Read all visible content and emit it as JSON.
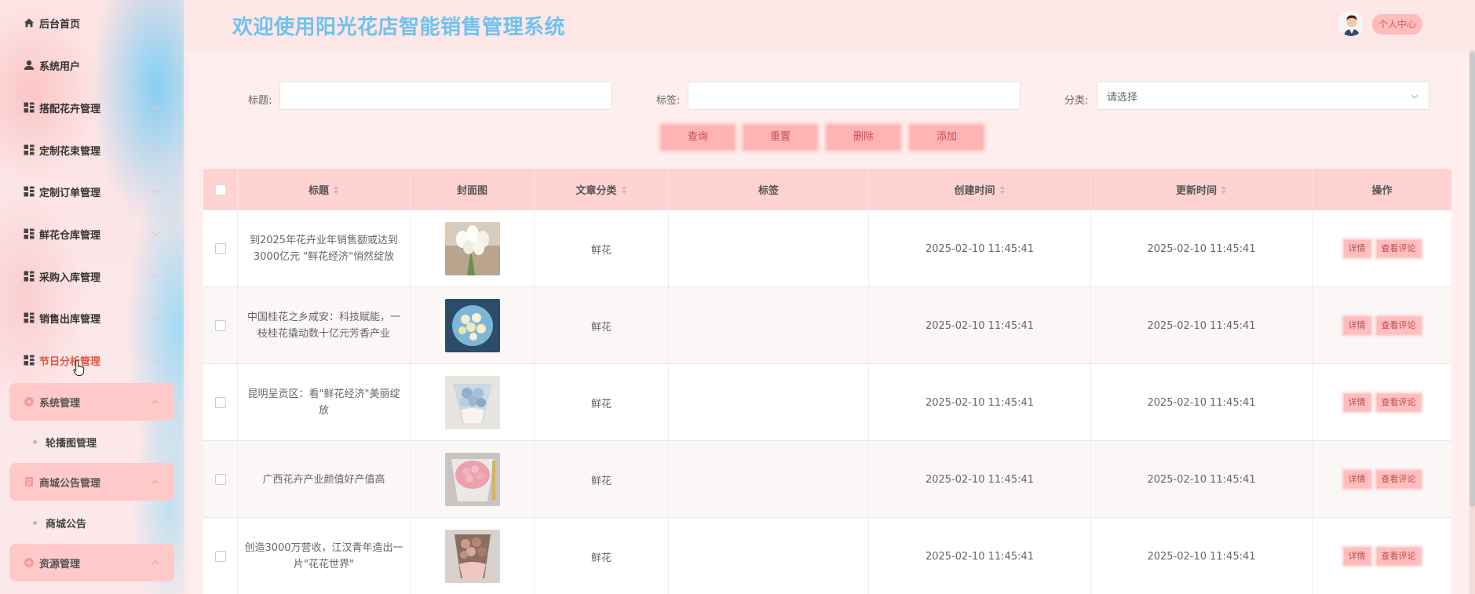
{
  "app_title": "欢迎使用阳光花店智能销售管理系统",
  "user_center_label": "个人中心",
  "sidebar": {
    "items": [
      {
        "label": "后台首页",
        "icon": "home-icon"
      },
      {
        "label": "系统用户",
        "icon": "user-icon"
      },
      {
        "label": "搭配花卉管理",
        "icon": "grid-icon"
      },
      {
        "label": "定制花束管理",
        "icon": "grid-icon"
      },
      {
        "label": "定制订单管理",
        "icon": "grid-icon"
      },
      {
        "label": "鲜花仓库管理",
        "icon": "grid-icon"
      },
      {
        "label": "采购入库管理",
        "icon": "grid-icon"
      },
      {
        "label": "销售出库管理",
        "icon": "grid-icon"
      },
      {
        "label": "节日分析管理",
        "icon": "grid-icon"
      }
    ],
    "groups": [
      {
        "label": "系统管理",
        "icon": "gear-icon",
        "sub": "轮播图管理"
      },
      {
        "label": "商城公告管理",
        "icon": "document-icon",
        "sub": "商城公告"
      },
      {
        "label": "资源管理",
        "icon": "plus-circle-icon"
      }
    ]
  },
  "filters": {
    "title_label": "标题:",
    "tag_label": "标签:",
    "category_label": "分类:",
    "category_placeholder": "请选择"
  },
  "buttons": {
    "search": "查询",
    "reset": "重置",
    "delete": "删除",
    "add": "添加"
  },
  "table": {
    "columns": {
      "title": "标题",
      "cover": "封面图",
      "category": "文章分类",
      "tags": "标签",
      "created": "创建时间",
      "updated": "更新时间",
      "ops": "操作"
    },
    "rows": [
      {
        "title": "到2025年花卉业年销售额或达到3000亿元 \"鲜花经济\"悄然绽放",
        "category": "鲜花",
        "tags": "",
        "created": "2025-02-10 11:45:41",
        "updated": "2025-02-10 11:45:41"
      },
      {
        "title": "中国桂花之乡咸安：科技赋能，一枝桂花撬动数十亿元芳香产业",
        "category": "鲜花",
        "tags": "",
        "created": "2025-02-10 11:45:41",
        "updated": "2025-02-10 11:45:41"
      },
      {
        "title": "昆明呈贡区：看\"鲜花经济\"美丽绽放",
        "category": "鲜花",
        "tags": "",
        "created": "2025-02-10 11:45:41",
        "updated": "2025-02-10 11:45:41"
      },
      {
        "title": "广西花卉产业颜值好产值高",
        "category": "鲜花",
        "tags": "",
        "created": "2025-02-10 11:45:41",
        "updated": "2025-02-10 11:45:41"
      },
      {
        "title": "创造3000万营收，江汉青年造出一片\"花花世界\"",
        "category": "鲜花",
        "tags": "",
        "created": "2025-02-10 11:45:41",
        "updated": "2025-02-10 11:45:41"
      }
    ],
    "op_detail": "详情",
    "op_comments": "查看评论"
  },
  "colors": {
    "accent": "#6fc2ef",
    "button_bg": "#ffb3b3",
    "header_row": "#ffd2d2",
    "active_nav": "#e0573f"
  }
}
